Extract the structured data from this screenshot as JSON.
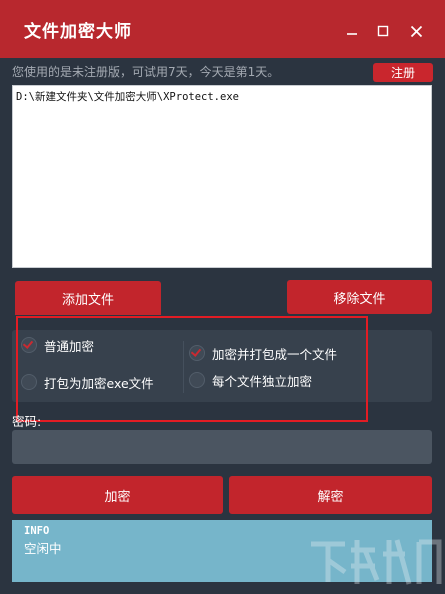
{
  "window": {
    "title": "文件加密大师",
    "controls": [
      "minimize-icon",
      "maximize-icon",
      "close-icon"
    ]
  },
  "status_line": "您使用的是未注册版，可试用7天，今天是第1天。",
  "register_label": "注册",
  "file_list": {
    "items": [
      "D:\\新建文件夹\\文件加密大师\\XProtect.exe"
    ]
  },
  "buttons": {
    "add_file": "添加文件",
    "remove_file": "移除文件",
    "encrypt": "加密",
    "decrypt": "解密"
  },
  "options": {
    "normal_encrypt": {
      "label": "普通加密",
      "checked": true
    },
    "pack_exe": {
      "label": "打包为加密exe文件",
      "checked": false
    },
    "encrypt_pack_one": {
      "label": "加密并打包成一个文件",
      "checked": true
    },
    "each_file_separate": {
      "label": "每个文件独立加密",
      "checked": false
    }
  },
  "password": {
    "label": "密码:",
    "value": ""
  },
  "info": {
    "title": "INFO",
    "status": "空闲中"
  },
  "colors": {
    "accent": "#c2252c",
    "background": "#2b3440",
    "info_panel": "#76b5ca",
    "highlight": "#e21c24"
  }
}
